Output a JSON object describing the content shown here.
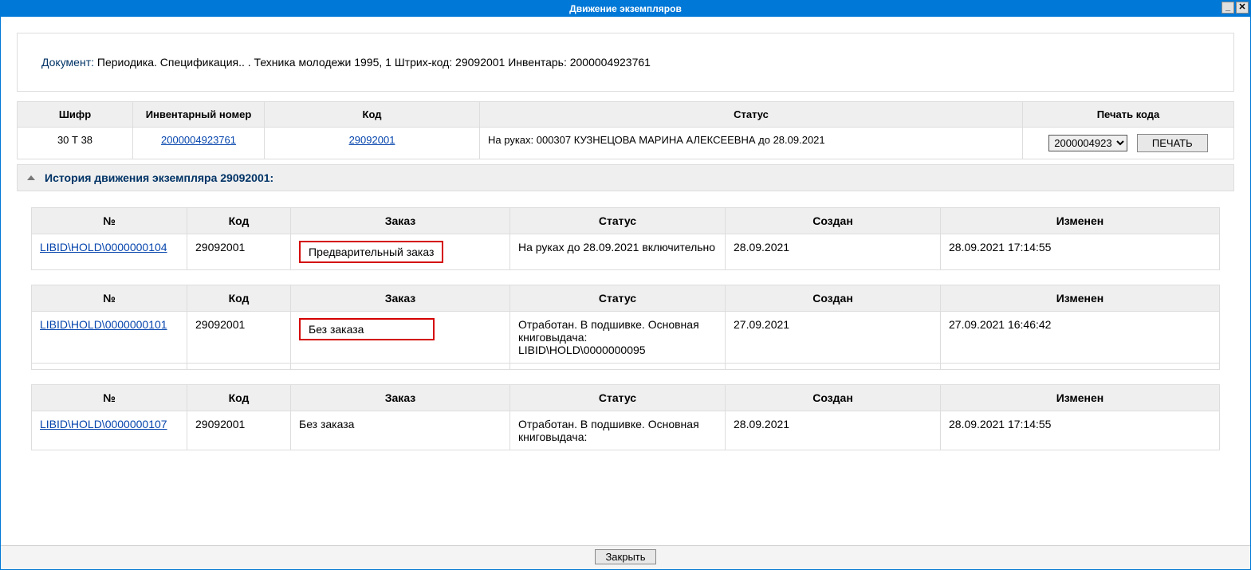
{
  "window": {
    "title": "Движение экземпляров",
    "minimize": "_",
    "close": "✕"
  },
  "doc": {
    "label": "Документ:",
    "rest": " Периодика. Спецификация.. . Техника молодежи 1995, 1 Штрих-код: 29092001 Инвентарь: 2000004923761"
  },
  "mainTable": {
    "headers": {
      "cipher": "Шифр",
      "inventory": "Инвентарный номер",
      "code": "Код",
      "status": "Статус",
      "print": "Печать кода"
    },
    "row": {
      "cipher": "30 Т 38",
      "inventory": "2000004923761",
      "code": "29092001",
      "status": "На руках: 000307 КУЗНЕЦОВА МАРИНА АЛЕКСЕЕВНА до 28.09.2021"
    },
    "printSelect": "2000004923",
    "printBtn": "ПЕЧАТЬ"
  },
  "accordion": {
    "title": "История движения экземпляра 29092001:"
  },
  "historyHeaders": {
    "num": "№",
    "code": "Код",
    "order": "Заказ",
    "status": "Статус",
    "created": "Создан",
    "changed": "Изменен"
  },
  "history": [
    {
      "num": "LIBID\\HOLD\\0000000104",
      "code": "29092001",
      "order": "Предварительный заказ",
      "orderHighlight": true,
      "status": "На руках до 28.09.2021 включительно",
      "created": "28.09.2021",
      "changed": "28.09.2021 17:14:55"
    },
    {
      "num": "LIBID\\HOLD\\0000000101",
      "code": "29092001",
      "order": "Без заказа",
      "orderHighlight": true,
      "status": "Отработан. В подшивке. Основная книговыдача: LIBID\\HOLD\\0000000095",
      "created": "27.09.2021",
      "changed": "27.09.2021 16:46:42"
    },
    {
      "num": "LIBID\\HOLD\\0000000107",
      "code": "29092001",
      "order": "Без заказа",
      "orderHighlight": false,
      "status": "Отработан. В подшивке. Основная книговыдача:",
      "created": "28.09.2021",
      "changed": "28.09.2021 17:14:55"
    }
  ],
  "footer": {
    "close": "Закрыть"
  }
}
